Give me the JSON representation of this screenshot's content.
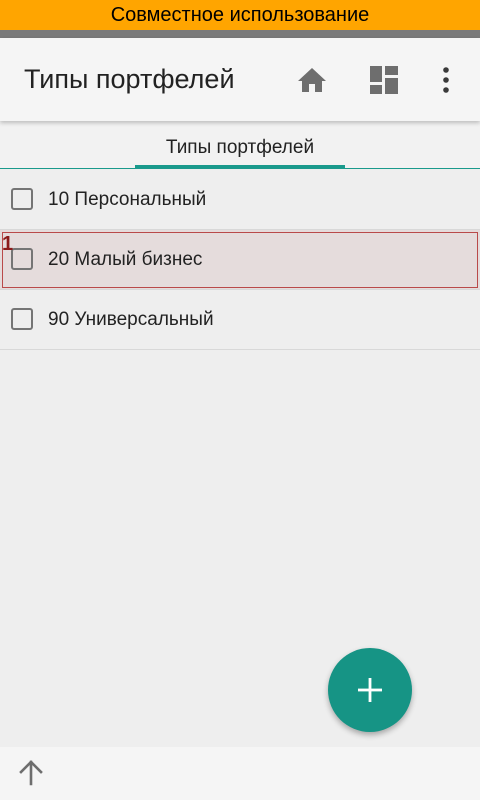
{
  "banner": {
    "text": "Совместное использование"
  },
  "app_bar": {
    "title": "Типы портфелей",
    "actions": [
      {
        "icon": "home-icon"
      },
      {
        "icon": "dashboard-icon"
      },
      {
        "icon": "more-vert-icon"
      }
    ]
  },
  "tabs": [
    {
      "label": "Типы портфелей",
      "selected": true
    }
  ],
  "list": {
    "items": [
      {
        "label": "10 Персональный",
        "checked": false
      },
      {
        "label": "20 Малый бизнес",
        "checked": false,
        "badge": "1"
      },
      {
        "label": "90 Универсальный",
        "checked": false
      }
    ]
  },
  "fab": {
    "icon": "add-icon"
  },
  "bottom_bar": {
    "icon": "arrow-up-icon"
  },
  "colors": {
    "banner": "#ffa500",
    "accent": "#169485",
    "background": "#eeeeee",
    "highlight_border": "#b94a4a"
  }
}
